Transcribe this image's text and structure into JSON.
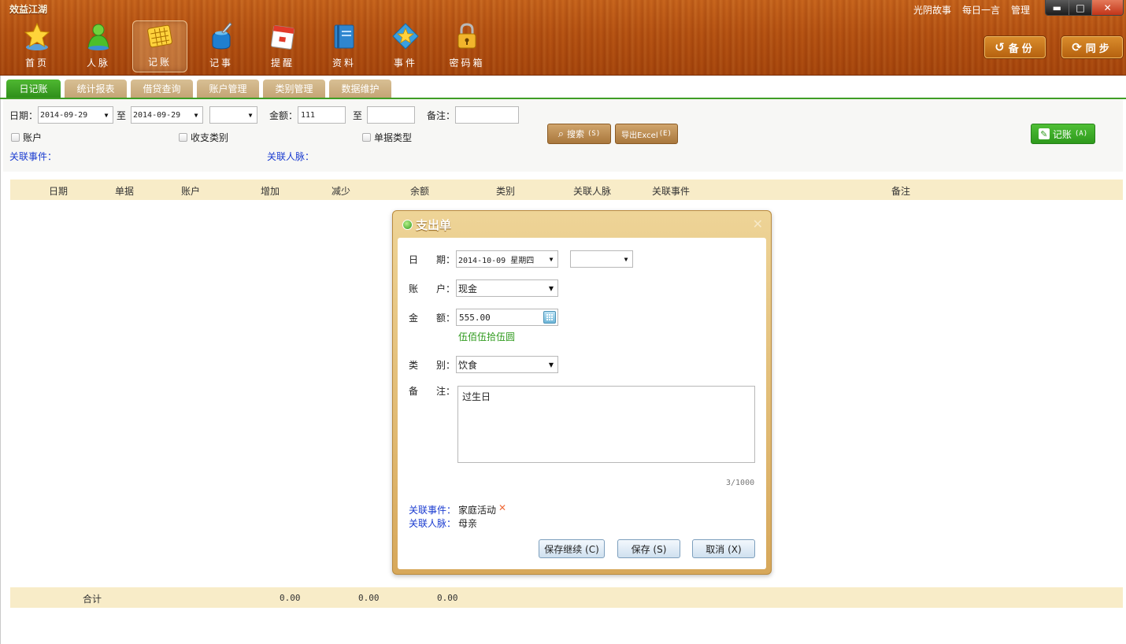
{
  "app": {
    "title": "效益江湖"
  },
  "top_links": [
    "光阴故事",
    "每日一言",
    "管理"
  ],
  "window_controls": {
    "minimize": "▬",
    "maximize": "□",
    "close": "✕"
  },
  "nav": [
    {
      "label": "首页",
      "icon": "star-icon"
    },
    {
      "label": "人脉",
      "icon": "contacts-icon"
    },
    {
      "label": "记账",
      "icon": "ledger-icon",
      "active": true
    },
    {
      "label": "记事",
      "icon": "ink-pen-icon"
    },
    {
      "label": "提醒",
      "icon": "calendar-icon"
    },
    {
      "label": "资料",
      "icon": "book-icon"
    },
    {
      "label": "事件",
      "icon": "event-icon"
    },
    {
      "label": "密码箱",
      "icon": "lock-icon"
    }
  ],
  "header_buttons": {
    "backup": "备份",
    "sync": "同步"
  },
  "tabs": [
    "日记账",
    "统计报表",
    "借贷查询",
    "账户管理",
    "类别管理",
    "数据维护"
  ],
  "filter": {
    "date_label": "日期：",
    "date_from": "2014-09-29",
    "to_label": "至",
    "date_to": "2014-09-29",
    "range_select": "",
    "amount_label": "金额：",
    "amount_from": "111",
    "amount_to": "",
    "note_label": "备注：",
    "note_value": "",
    "chk_account": "账户",
    "chk_category": "收支类别",
    "chk_doctype": "单据类型",
    "related_event": "关联事件：",
    "related_contact": "关联人脉：",
    "search_btn": "搜索",
    "search_key": "(S)",
    "export_btn": "导出Excel",
    "export_key": "(E)",
    "record_btn": "记账",
    "record_key": "(A)"
  },
  "table": {
    "columns": [
      "日期",
      "单据",
      "账户",
      "增加",
      "减少",
      "余额",
      "类别",
      "关联人脉",
      "关联事件",
      "备注"
    ],
    "footer": {
      "label": "合计",
      "increase": "0.00",
      "decrease": "0.00",
      "balance": "0.00"
    }
  },
  "dialog": {
    "title": "支出单",
    "close": "✕",
    "date_label_1": "日",
    "date_label_2": "期：",
    "date_value": "2014-10-09 星期四",
    "time_value": "",
    "account_label_1": "账",
    "account_label_2": "户：",
    "account_value": "现金",
    "amount_label_1": "金",
    "amount_label_2": "额：",
    "amount_value": "555.00",
    "amount_chinese": "伍佰伍拾伍圆",
    "category_label_1": "类",
    "category_label_2": "别：",
    "category_value": "饮食",
    "note_label_1": "备",
    "note_label_2": "注：",
    "note_value": "过生日",
    "char_count": "3/1000",
    "related_event_label": "关联事件：",
    "related_event_value": "家庭活动",
    "related_contact_label": "关联人脉：",
    "related_contact_value": "母亲",
    "btn_save_continue": "保存继续 (C)",
    "btn_save": "保存 (S)",
    "btn_cancel": "取消 (X)"
  },
  "colors": {
    "wood": "#b24f10",
    "tab_active": "#3f9e25",
    "tab_inactive": "#cdb084",
    "link": "#1a3bd0",
    "amount_chinese": "#2e9a1c"
  }
}
